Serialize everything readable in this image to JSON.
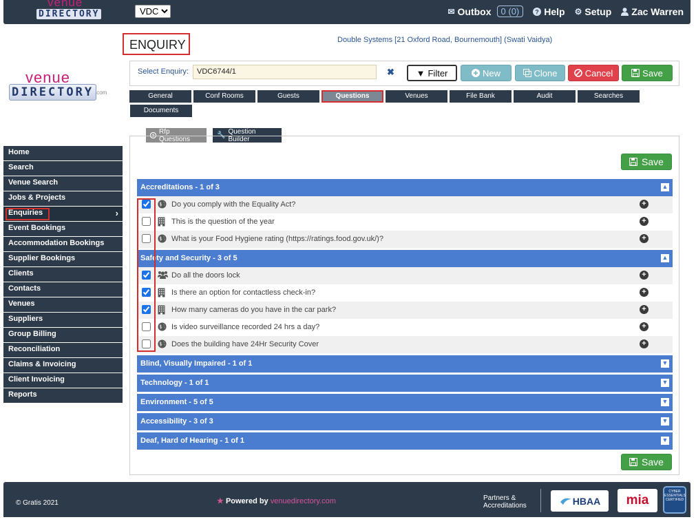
{
  "brand": {
    "venue": "venue",
    "directory": "DIRECTORY",
    "com": ".com"
  },
  "topbar": {
    "company_select": "VDC",
    "outbox_label": "Outbox",
    "outbox_count": "0 (0)",
    "help_label": "Help",
    "setup_label": "Setup",
    "user_name": "Zac Warren"
  },
  "sidebar": {
    "items": [
      {
        "label": "Home"
      },
      {
        "label": "Search"
      },
      {
        "label": "Venue Search"
      },
      {
        "label": "Jobs & Projects"
      },
      {
        "label": "Enquiries"
      },
      {
        "label": "Event Bookings"
      },
      {
        "label": "Accommodation Bookings"
      },
      {
        "label": "Supplier Bookings"
      },
      {
        "label": "Clients"
      },
      {
        "label": "Contacts"
      },
      {
        "label": "Venues"
      },
      {
        "label": "Suppliers"
      },
      {
        "label": "Group Billing"
      },
      {
        "label": "Reconciliation"
      },
      {
        "label": "Claims & Invoicing"
      },
      {
        "label": "Client Invoicing"
      },
      {
        "label": "Reports"
      }
    ]
  },
  "page": {
    "title": "ENQUIRY",
    "client_line": "Double Systems [21 Oxford Road, Bournemouth] (Swati Vaidya)"
  },
  "enquiry_bar": {
    "label": "Select Enquiry:",
    "value": "VDC6744/1",
    "filter": "Filter",
    "new": "New",
    "clone": "Clone",
    "cancel": "Cancel",
    "save": "Save"
  },
  "tabs": {
    "row1": [
      "General",
      "Conf Rooms",
      "Guests",
      "Questions",
      "Venues",
      "File Bank",
      "Audit",
      "Searches"
    ],
    "row2": [
      "Documents"
    ],
    "active": "Questions"
  },
  "subtabs": {
    "rfp": "Rfp Questions",
    "builder": "Question Builder"
  },
  "save_label": "Save",
  "groups": [
    {
      "title": "Accreditations - 1 of 3",
      "expanded": true,
      "questions": [
        {
          "text": "Do you comply with the Equality Act?",
          "checked": true,
          "icon": "globe-icon"
        },
        {
          "text": "This is the question of the year",
          "checked": false,
          "icon": "building-icon"
        },
        {
          "text": "What is your Food Hygiene rating (https://ratings.food.gov.uk/)?",
          "checked": false,
          "icon": "globe-icon"
        }
      ]
    },
    {
      "title": "Safety and Security - 3 of 5",
      "expanded": true,
      "questions": [
        {
          "text": "Do all the doors lock",
          "checked": true,
          "icon": "users-icon"
        },
        {
          "text": "Is there an option for contactless check-in?",
          "checked": true,
          "icon": "building-icon"
        },
        {
          "text": "How many cameras do you have in the car park?",
          "checked": true,
          "icon": "building-icon"
        },
        {
          "text": "Is video surveillance recorded 24 hrs a day?",
          "checked": false,
          "icon": "globe-icon"
        },
        {
          "text": "Does the building have 24Hr Security Cover",
          "checked": false,
          "icon": "globe-icon"
        }
      ]
    },
    {
      "title": "Blind, Visually Impaired - 1 of 1",
      "expanded": false
    },
    {
      "title": "Technology - 1 of 1",
      "expanded": false
    },
    {
      "title": "Environment - 5 of 5",
      "expanded": false
    },
    {
      "title": "Accessibility - 3 of 3",
      "expanded": false
    },
    {
      "title": "Deaf, Hard of Hearing - 1 of 1",
      "expanded": false
    }
  ],
  "footer": {
    "copyright": "© Gratis 2021",
    "powered_by": "Powered by",
    "powered_site": "venuedirectory.com",
    "partners_line1": "Partners &",
    "partners_line2": "Accreditations",
    "hbaa": "HBAA",
    "mia": "mia",
    "cyber": "CYBER ESSENTIALS CERTIFIED"
  }
}
